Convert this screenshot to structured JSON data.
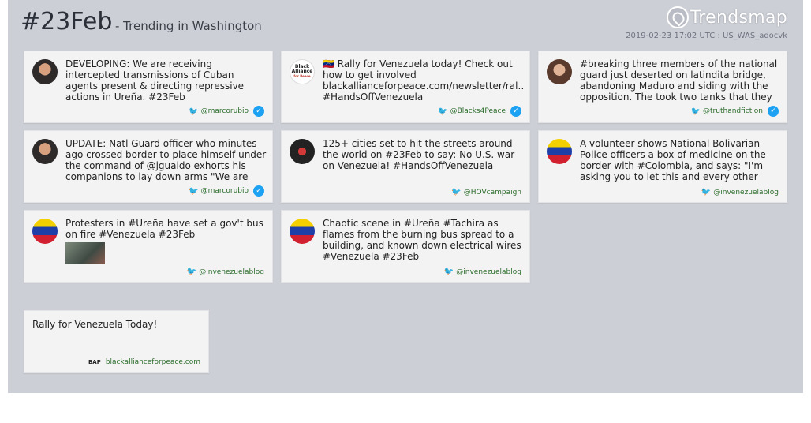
{
  "header": {
    "hashtag": "#23Feb",
    "subtitle": "- Trending in Washington",
    "logo": "Trendsmap",
    "meta": "2019-02-23 17:02 UTC : US_WAS_adocvk"
  },
  "tweets": [
    {
      "text": "DEVELOPING: We are receiving intercepted transmissions of Cuban agents present & directing repressive actions in Ureña. #23Feb",
      "handle": "@marcorubio",
      "verified": true,
      "avatar": "person1"
    },
    {
      "text": "🇻🇪 Rally for Venezuela today! Check out how to get involved blackallianceforpeace.com/newsletter/ral… #HandsOffVenezuela",
      "handle": "@Blacks4Peace",
      "verified": true,
      "avatar": "bap"
    },
    {
      "text": "#breaking three members of the national guard just deserted on latindita bridge, abandoning Maduro and siding with the opposition. The took two tanks that they",
      "handle": "@truthandfiction",
      "verified": true,
      "avatar": "person2"
    },
    {
      "text": "UPDATE: Natl Guard officer who minutes ago crossed border to place himself under the command of @jguaido exhorts his companions to lay down arms \"We are",
      "handle": "@marcorubio",
      "verified": true,
      "avatar": "person1"
    },
    {
      "text": "125+ cities set to hit the streets around the world on #23Feb to say: No U.S. war on Venezuela! #HandsOffVenezuela",
      "handle": "@HOVcampaign",
      "verified": false,
      "avatar": "hov"
    },
    {
      "text": "A volunteer shows National Bolivarian Police officers a box of medicine on the border with #Colombia, and says: \"I'm asking you to let this and every other",
      "handle": "@invenezuelablog",
      "verified": false,
      "avatar": "flag"
    },
    {
      "text": "Protesters in #Ureña have set a gov't bus on fire #Venezuela #23Feb",
      "handle": "@invenezuelablog",
      "verified": false,
      "avatar": "flag"
    },
    {
      "text": "Chaotic scene in #Ureña #Tachira as flames from the burning bus spread to a building, and known down electrical wires #Venezuela #23Feb",
      "handle": "@invenezuelablog",
      "verified": false,
      "avatar": "flag"
    }
  ],
  "link_card": {
    "text": "Rally for Venezuela Today!",
    "domain": "blackallianceforpeace.com",
    "badge": "BAP"
  },
  "icons": {
    "bird": "twitter-bird-icon",
    "check": "verified-check-icon"
  }
}
